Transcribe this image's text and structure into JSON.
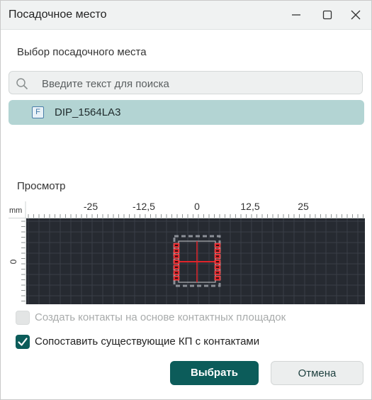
{
  "window": {
    "title": "Посадочное место"
  },
  "footprint_section": {
    "label": "Выбор посадочного места"
  },
  "search": {
    "placeholder": "Введите текст для поиска",
    "value": ""
  },
  "footprints": [
    {
      "badge": "F",
      "name": "DIP_1564LA3",
      "selected": true
    }
  ],
  "preview": {
    "label": "Просмотр",
    "unit": "mm",
    "x_ticks": [
      "-25",
      "-12,5",
      "0",
      "12,5",
      "25"
    ],
    "y_ticks": [
      "0"
    ]
  },
  "options": {
    "create_contacts": {
      "label": "Создать контакты на основе контактных площадок",
      "checked": false,
      "disabled": true
    },
    "match_pads": {
      "label": "Сопоставить существующие КП с контактами",
      "checked": true,
      "disabled": false
    }
  },
  "buttons": {
    "select": "Выбрать",
    "cancel": "Отмена"
  },
  "colors": {
    "accent": "#0c5c5a",
    "selection": "#b3d4d3",
    "canvas": "#262a31",
    "pad": "#e0242a"
  }
}
